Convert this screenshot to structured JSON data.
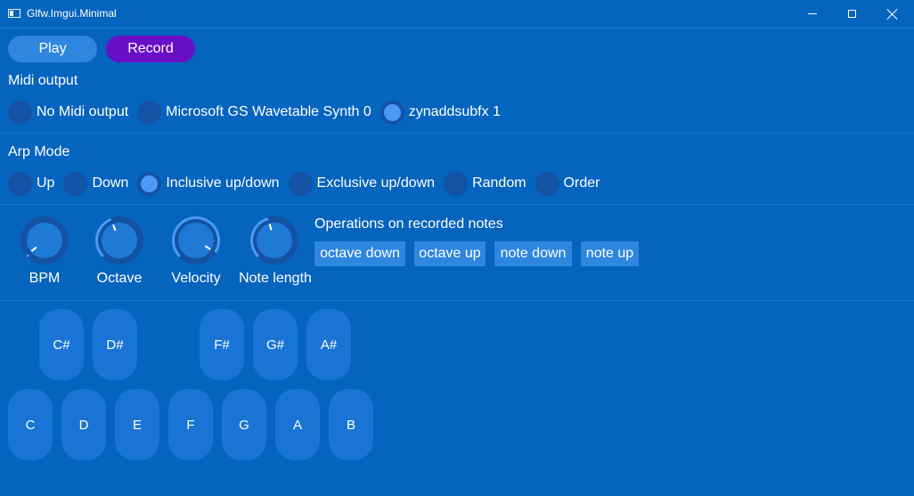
{
  "window": {
    "title": "Glfw.Imgui.Minimal"
  },
  "transport": {
    "play_label": "Play",
    "record_label": "Record"
  },
  "midi_output": {
    "label": "Midi output",
    "options": [
      "No Midi output",
      "Microsoft GS Wavetable Synth 0",
      "zynaddsubfx 1"
    ],
    "selected": "zynaddsubfx 1"
  },
  "arp_mode": {
    "label": "Arp Mode",
    "options": [
      "Up",
      "Down",
      "Inclusive up/down",
      "Exclusive up/down",
      "Random",
      "Order"
    ],
    "selected": "Inclusive up/down"
  },
  "knobs": [
    {
      "label": "BPM",
      "value_fraction": 0.02
    },
    {
      "label": "Octave",
      "value_fraction": 0.42
    },
    {
      "label": "Velocity",
      "value_fraction": 0.95
    },
    {
      "label": "Note length",
      "value_fraction": 0.44
    }
  ],
  "operations": {
    "title": "Operations on recorded notes",
    "buttons": [
      "octave down",
      "octave up",
      "note down",
      "note up"
    ]
  },
  "keyboard": {
    "black_keys": [
      "C#",
      "D#",
      "F#",
      "G#",
      "A#"
    ],
    "white_keys": [
      "C",
      "D",
      "E",
      "F",
      "G",
      "A",
      "B"
    ]
  },
  "colors": {
    "background": "#0564be",
    "button": "#2e86df",
    "record": "#6a0fc8",
    "radio_off": "#1452a4",
    "radio_on": "#4b9bf5",
    "key": "#1a74d6"
  }
}
